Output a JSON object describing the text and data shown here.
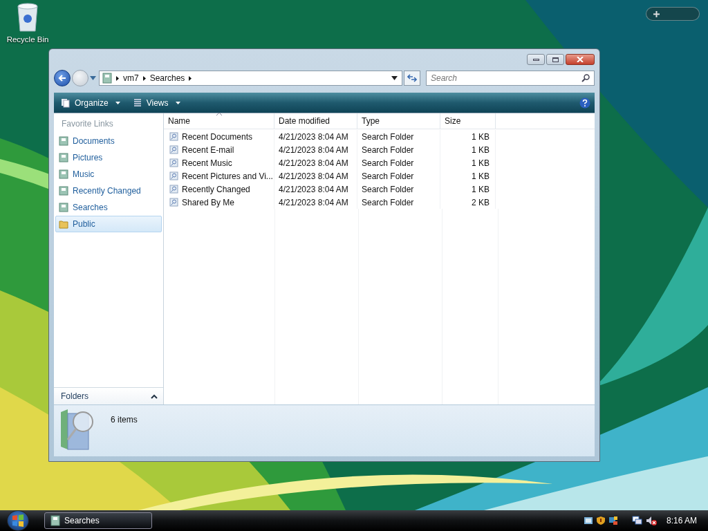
{
  "desktop": {
    "icons": [
      {
        "label": "Recycle Bin"
      }
    ]
  },
  "window": {
    "breadcrumb": [
      "vm7",
      "Searches"
    ],
    "search": {
      "placeholder": "Search"
    },
    "toolbar": [
      "Organize",
      "Views"
    ],
    "favorite_links": {
      "heading": "Favorite Links",
      "items": [
        {
          "label": "Documents",
          "selected": false
        },
        {
          "label": "Pictures",
          "selected": false
        },
        {
          "label": "Music",
          "selected": false
        },
        {
          "label": "Recently Changed",
          "selected": false
        },
        {
          "label": "Searches",
          "selected": false
        },
        {
          "label": "Public",
          "selected": true
        }
      ]
    },
    "folders": {
      "label": "Folders"
    },
    "table": {
      "columns": [
        {
          "label": "Name",
          "sorted": true
        },
        {
          "label": "Date modified",
          "sorted": false
        },
        {
          "label": "Type",
          "sorted": false
        },
        {
          "label": "Size",
          "sorted": false
        }
      ],
      "rows": [
        [
          "Recent Documents",
          "4/21/2023 8:04 AM",
          "Search Folder",
          "1 KB"
        ],
        [
          "Recent E-mail",
          "4/21/2023 8:04 AM",
          "Search Folder",
          "1 KB"
        ],
        [
          "Recent Music",
          "4/21/2023 8:04 AM",
          "Search Folder",
          "1 KB"
        ],
        [
          "Recent Pictures and Vi...",
          "4/21/2023 8:04 AM",
          "Search Folder",
          "1 KB"
        ],
        [
          "Recently Changed",
          "4/21/2023 8:04 AM",
          "Search Folder",
          "1 KB"
        ],
        [
          "Shared By Me",
          "4/21/2023 8:04 AM",
          "Search Folder",
          "2 KB"
        ]
      ]
    },
    "status": "6 items"
  },
  "taskbar": {
    "tasks": [
      {
        "label": "Searches",
        "selected": true
      }
    ],
    "clock": "8:16 AM"
  }
}
